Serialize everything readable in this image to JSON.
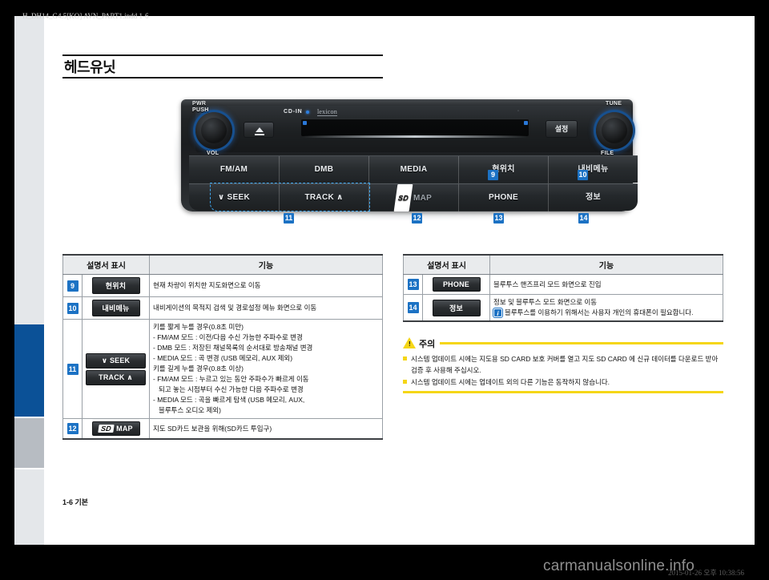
{
  "page": {
    "title": "헤드유닛",
    "footer": "1-6 기본",
    "print_file": "H_DH14_G4.5[KO] AVN_PART1.indd   1-6",
    "print_date": "2015-01-26   오후 10:38:56",
    "watermark": "carmanualsonline.info"
  },
  "device": {
    "labels": {
      "pwr": "PWR",
      "push": "PUSH",
      "vol": "VOL",
      "tune": "TUNE",
      "file": "FILE",
      "cd_in": "CD-IN",
      "lexicon": "lexicon",
      "setting": "설정",
      "slot_mark": "◦"
    },
    "row_top": [
      {
        "label": "FM/AM",
        "callout": null
      },
      {
        "label": "DMB",
        "callout": null
      },
      {
        "label": "MEDIA",
        "callout": null
      },
      {
        "label": "현위치",
        "callout": "9"
      },
      {
        "label": "내비메뉴",
        "callout": "10"
      }
    ],
    "row_bottom": [
      {
        "label": "∨ SEEK",
        "callout": "11"
      },
      {
        "label": "TRACK ∧",
        "callout": null
      },
      {
        "label": "MAP",
        "callout": "12",
        "glyph": "SD"
      },
      {
        "label": "PHONE",
        "callout": "13"
      },
      {
        "label": "정보",
        "callout": "14"
      }
    ]
  },
  "table_left": {
    "headers": [
      "설명서 표시",
      "기능"
    ],
    "rows": [
      {
        "num": "9",
        "key": "현위치",
        "key_type": "button",
        "lines": [
          "현재 차량이 위치한 지도화면으로 이동"
        ]
      },
      {
        "num": "10",
        "key": "내비메뉴",
        "key_type": "button",
        "lines": [
          "내비게이션의 목적지 검색 및 경로설정 메뉴 화면으로 이동"
        ]
      },
      {
        "num": "11",
        "key_stack": [
          "∨ SEEK",
          "TRACK ∧"
        ],
        "key_type": "stack",
        "lines": [
          "키를 짧게 누를 경우(0.8초 미만)",
          "- FM/AM 모드 : 이전/다음 수신 가능한 주파수로 변경",
          "- DMB 모드 : 저장된 채널목록의 순서대로 방송채널 변경",
          "- MEDIA 모드 : 곡 변경 (USB 메모리, AUX 제외)",
          "키를 길게 누를 경우(0.8초 이상)",
          "- FM/AM 모드 : 누르고 있는 동안 주파수가 빠르게 이동",
          "  되고 놓는 시점부터 수신 가능한 다음 주파수로 변경",
          "- MEDIA 모드 : 곡을 빠르게 탐색 (USB 메모리, AUX,",
          "  블루투스 오디오 제외)"
        ]
      },
      {
        "num": "12",
        "key": "MAP",
        "key_type": "sd",
        "key_glyph": "SD",
        "lines": [
          "지도 SD카드 보관을 위해(SD카드 투입구)"
        ]
      }
    ]
  },
  "table_right": {
    "headers": [
      "설명서 표시",
      "기능"
    ],
    "rows": [
      {
        "num": "13",
        "key": "PHONE",
        "key_type": "button",
        "lines": [
          "블루투스 핸즈프리 모드 화면으로 진입"
        ]
      },
      {
        "num": "14",
        "key": "정보",
        "key_type": "button",
        "lines": [
          "정보 및 블루투스 모드 화면으로 이동"
        ],
        "note": "블루투스를 이용하기 위해서는 사용자 개인의 휴대폰이 필요합니다."
      }
    ]
  },
  "caution": {
    "heading": "주의",
    "items": [
      "시스템 업데이트 시에는 지도용 SD CARD 보호 커버를 열고 지도 SD CARD 에 신규 데이터를 다운로드 받아 검증 후 사용해 주십시오.",
      "시스템 업데이트 시에는 업데이트 외의 다른 기능은 동작하지 않습니다."
    ]
  },
  "colors": {
    "callout_blue": "#1c72c4",
    "tab_blue": "#0b5197",
    "caution_yellow": "#f5d617"
  }
}
